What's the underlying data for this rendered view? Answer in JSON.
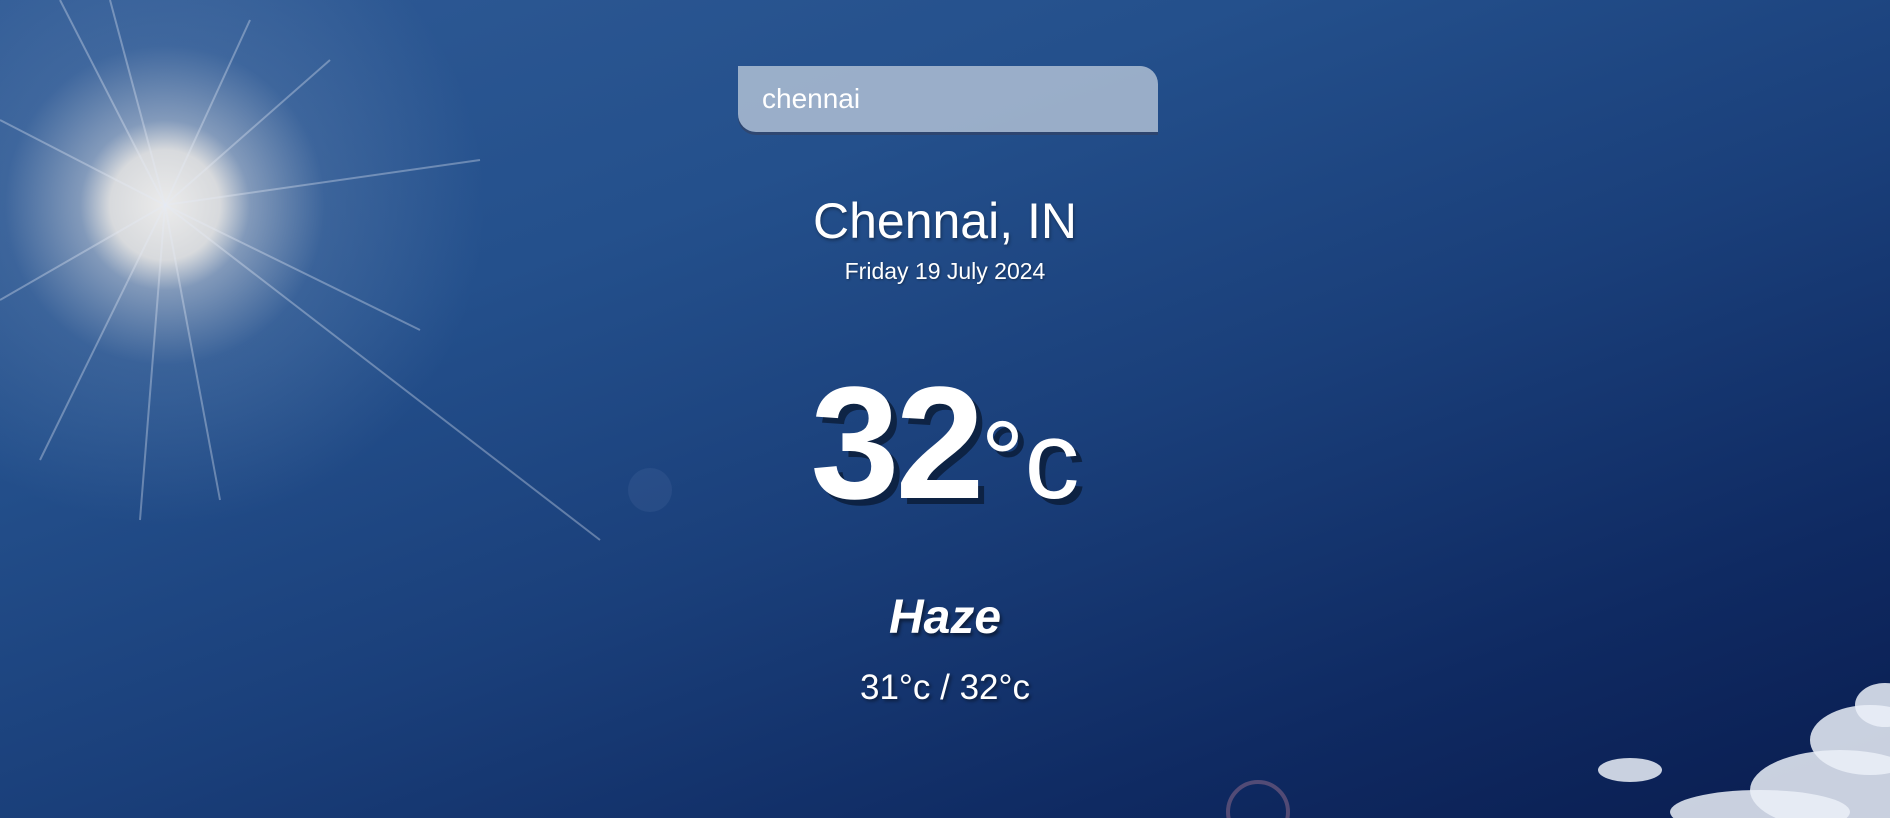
{
  "search": {
    "value": "chennai"
  },
  "location": {
    "city_country": "Chennai, IN",
    "date": "Friday 19 July 2024"
  },
  "current": {
    "temperature": "32",
    "unit": "°c",
    "condition": "Haze",
    "hi_low": "31°c / 32°c"
  },
  "background": {
    "description_icon": "sun-icon",
    "sky_color": "#1a3f7a",
    "sun_color": "#e6e6e6"
  }
}
